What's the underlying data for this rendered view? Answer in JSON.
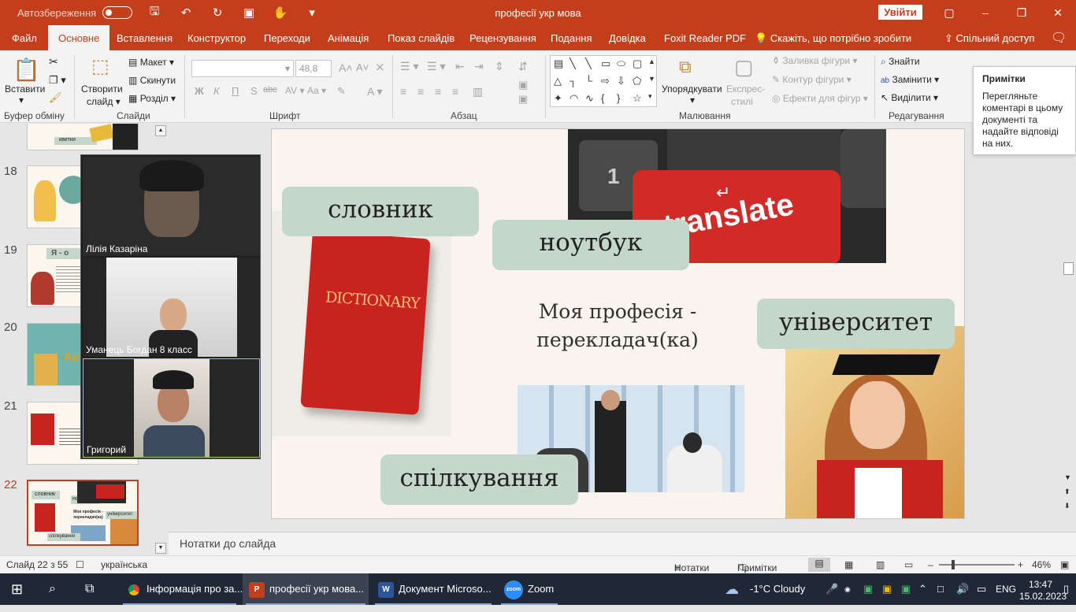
{
  "titlebar": {
    "autosave_label": "Автозбереження",
    "doc_title": "професії укр мова",
    "signin": "Увійти"
  },
  "menu": {
    "file": "Файл",
    "home": "Основне",
    "insert": "Вставлення",
    "design": "Конструктор",
    "transitions": "Переходи",
    "animation": "Анімація",
    "slideshow": "Показ слайдів",
    "review": "Рецензування",
    "view": "Подання",
    "help": "Довідка",
    "foxit": "Foxit Reader PDF",
    "tell_me": "Скажіть, що потрібно зробити",
    "share": "Спільний доступ"
  },
  "ribbon": {
    "paste": "Вставити",
    "clipboard_group": "Буфер обміну",
    "new_slide": "Створити",
    "new_slide_2": "слайд",
    "layout": "Макет",
    "reset": "Скинути",
    "section": "Розділ",
    "slides_group": "Слайди",
    "font_size": "48,8",
    "font_group": "Шрифт",
    "bold": "Ж",
    "italic": "К",
    "underline": "П",
    "strike": "S",
    "paragraph_group": "Абзац",
    "arrange": "Упорядкувати",
    "quick_styles": "Експрес-",
    "quick_styles_2": "стилі",
    "fill": "Заливка фігури",
    "outline": "Контур фігури",
    "effects": "Ефекти для фігур",
    "drawing_group": "Малювання",
    "find": "Знайти",
    "replace": "Замінити",
    "select": "Виділити",
    "editing_group": "Редагування"
  },
  "tooltip": {
    "title": "Примітки",
    "body": "Перегляньте коментарі в цьому документі та надайте відповіді на них."
  },
  "thumbnails": [
    {
      "num": "18"
    },
    {
      "num": "19"
    },
    {
      "num": "20"
    },
    {
      "num": "21"
    },
    {
      "num": "22"
    }
  ],
  "thumb_texts": {
    "t17": "квитки",
    "t19": "Я - о",
    "t20": "Асо",
    "t22_1": "словник",
    "t22_2": "ноутбук",
    "t22_3": "університет",
    "t22_4": "спілкування",
    "t22_5": "Моя професія - перекладач(ка)"
  },
  "video": {
    "p1": "Лілія Казаріна",
    "p2": "Уманець Богдан 8 класс",
    "p3": "Григорий"
  },
  "slide": {
    "label_dictionary": "словник",
    "label_laptop": "ноутбук",
    "label_university": "університет",
    "label_communication": "спілкування",
    "title": "Моя професія - перекладач(ка)",
    "book_text": "DICTIONARY",
    "key_text": "translate",
    "key_one": "1"
  },
  "notes": {
    "placeholder": "Нотатки до слайда"
  },
  "status": {
    "slide_info": "Слайд 22 з 55",
    "language": "українська",
    "notes": "Нотатки",
    "comments": "Примітки",
    "zoom": "46%"
  },
  "taskbar": {
    "chrome": "Інформація про за...",
    "ppt": "професії укр мова...",
    "word": "Документ Microso...",
    "zoom": "Zoom",
    "zoom_icon": "zoom",
    "weather": "-1°C  Cloudy",
    "lang": "ENG",
    "time": "13:47",
    "date": "15.02.2023"
  },
  "colors": {
    "accent": "#c43e1c",
    "label_bg": "#c5d6cb",
    "taskbar": "#202737"
  }
}
